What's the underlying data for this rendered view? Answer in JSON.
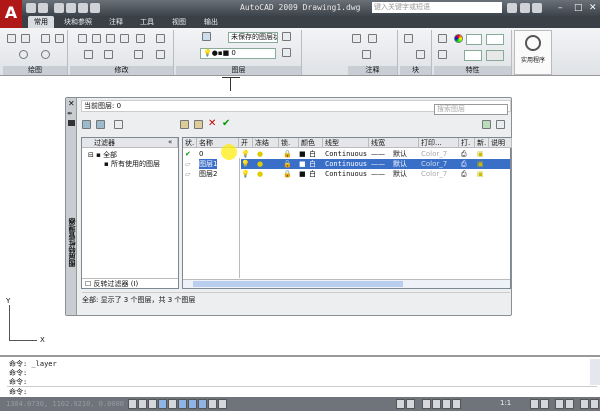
{
  "titlebar": {
    "app_title": "AutoCAD 2009 Drawing1.dwg",
    "search_placeholder": "键入关键字或短语",
    "min": "–",
    "max": "□",
    "close": "✕"
  },
  "tabs": [
    "常用",
    "块和参照",
    "注释",
    "工具",
    "视图",
    "输出"
  ],
  "ribbon": {
    "panels": [
      "绘图",
      "修改",
      "图层",
      "注释",
      "块",
      "特性"
    ],
    "layer_state": "未保存的图层状态",
    "current_layer": "0",
    "utility": "实用程序"
  },
  "dialog": {
    "vertical_title": "图层特性管理器",
    "current_layer_label": "当前图层: 0",
    "search_placeholder": "搜索图层",
    "tree": {
      "header": "过滤器",
      "items": [
        "全部",
        "所有使用的图层"
      ],
      "invert_filter": "反转过滤器 (I)"
    },
    "columns": [
      "状.",
      "名称",
      "开",
      "冻结",
      "锁.",
      "颜色",
      "线型",
      "线宽",
      "打印...",
      "打.",
      "新.",
      "说明"
    ],
    "layers": [
      {
        "name": "0",
        "color": "白",
        "linetype": "Continuous",
        "lineweight": "默认",
        "plot_style": "Color_7",
        "current": true,
        "selected": false
      },
      {
        "name": "图层1",
        "color": "白",
        "linetype": "Continuous",
        "lineweight": "默认",
        "plot_style": "Color_7",
        "current": false,
        "selected": true
      },
      {
        "name": "图层2",
        "color": "白",
        "linetype": "Continuous",
        "lineweight": "默认",
        "plot_style": "Color_7",
        "current": false,
        "selected": false
      }
    ],
    "status": "全部: 显示了 3 个图层，共 3 个图层"
  },
  "command": {
    "lines": [
      "命令: _layer",
      "命令:",
      "命令:"
    ],
    "prompt": "命令:"
  },
  "statusbar": {
    "coords": "1304.0730, 1102.9210, 0.0000",
    "scale": "1:1"
  },
  "ucs": {
    "x": "X",
    "y": "Y"
  }
}
